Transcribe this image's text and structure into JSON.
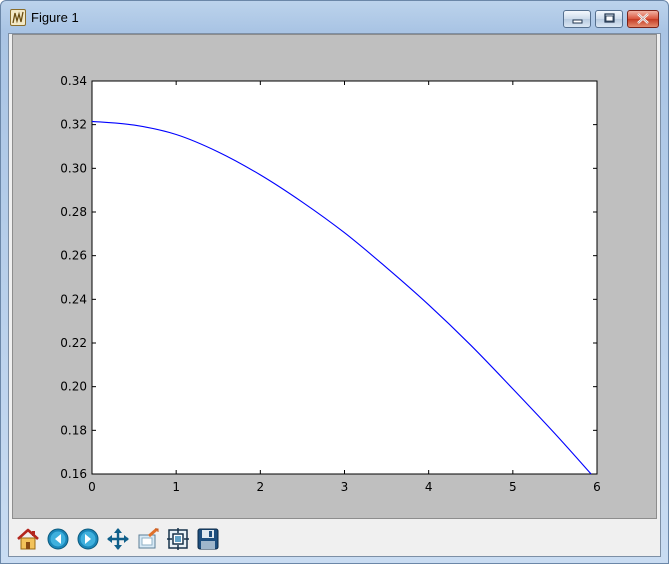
{
  "window": {
    "title": "Figure 1",
    "icon": "matplotlib-figure-icon"
  },
  "toolbar": {
    "buttons": [
      {
        "name": "home-button",
        "icon": "home-icon"
      },
      {
        "name": "back-button",
        "icon": "back-arrow-icon"
      },
      {
        "name": "forward-button",
        "icon": "forward-arrow-icon"
      },
      {
        "name": "pan-button",
        "icon": "pan-icon"
      },
      {
        "name": "zoom-button",
        "icon": "zoom-rect-icon"
      },
      {
        "name": "subplots-button",
        "icon": "subplots-icon"
      },
      {
        "name": "save-button",
        "icon": "save-icon"
      }
    ]
  },
  "chart_data": {
    "type": "line",
    "title": "",
    "xlabel": "",
    "ylabel": "",
    "xlim": [
      0,
      6
    ],
    "ylim": [
      0.16,
      0.34
    ],
    "xticks": [
      "0",
      "1",
      "2",
      "3",
      "4",
      "5",
      "6"
    ],
    "yticks": [
      "0.16",
      "0.18",
      "0.20",
      "0.22",
      "0.24",
      "0.26",
      "0.28",
      "0.30",
      "0.32",
      "0.34"
    ],
    "grid": false,
    "line_color": "#0000ff",
    "series": [
      {
        "x": [
          0,
          0.5,
          1,
          1.5,
          2,
          2.5,
          3,
          3.5,
          4,
          4.5,
          5,
          5.5,
          5.93
        ],
        "y": [
          0.3215,
          0.3198,
          0.3155,
          0.3075,
          0.297,
          0.2845,
          0.2705,
          0.2545,
          0.2375,
          0.219,
          0.199,
          0.1785,
          0.16
        ]
      }
    ]
  }
}
